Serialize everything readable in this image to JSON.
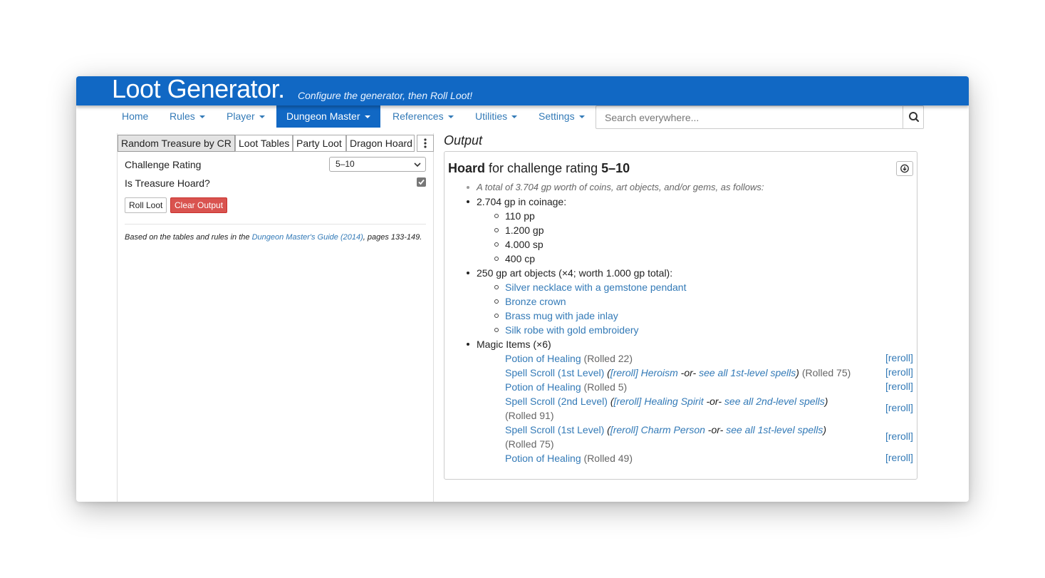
{
  "app": {
    "title": "Loot Generator.",
    "subtitle": "Configure the generator, then Roll Loot!"
  },
  "nav": {
    "items": [
      {
        "label": "Home"
      },
      {
        "label": "Rules"
      },
      {
        "label": "Player"
      },
      {
        "label": "Dungeon Master"
      },
      {
        "label": "References"
      },
      {
        "label": "Utilities"
      },
      {
        "label": "Settings"
      }
    ],
    "active": "Dungeon Master",
    "search_placeholder": "Search everywhere...",
    "search_icon": "search-icon"
  },
  "tabs": [
    {
      "label": "Random Treasure by CR"
    },
    {
      "label": "Loot Tables"
    },
    {
      "label": "Party Loot"
    },
    {
      "label": "Dragon Hoard"
    }
  ],
  "form": {
    "cr_label": "Challenge Rating",
    "cr_value": "5–10",
    "hoard_label": "Is Treasure Hoard?",
    "hoard_checked": true,
    "roll_button": "Roll Loot",
    "clear_button": "Clear Output",
    "note_prefix": "Based on the tables and rules in the ",
    "note_link": "Dungeon Master's Guide (2014)",
    "note_suffix": ", pages 133-149."
  },
  "output": {
    "heading": "Output",
    "title_bold": "Hoard",
    "title_middle": " for challenge rating ",
    "title_cr": "5–10",
    "summary": "A total of 3.704 gp worth of coins, art objects, and/or gems, as follows:",
    "coinage_header": "2.704 gp in coinage:",
    "coins": [
      "110 pp",
      "1.200 gp",
      "4.000 sp",
      "400 cp"
    ],
    "art_header": "250 gp art objects (×4; worth 1.000 gp total):",
    "art_objects": [
      "Silver necklace with a gemstone pendant",
      "Bronze crown",
      "Brass mug with jade inlay",
      "Silk robe with gold embroidery"
    ],
    "magic_header": "Magic Items (×6)",
    "reroll_label": "[reroll]",
    "or_text": " -or- ",
    "magic_items": [
      {
        "name": "Potion of Healing",
        "rolled": "(Rolled 22)"
      },
      {
        "name": "Spell Scroll (1st Level)",
        "spell_reroll": "[reroll]",
        "spell": "Heroism",
        "see_all": "see all 1st-level spells",
        "rolled": "(Rolled 75)"
      },
      {
        "name": "Potion of Healing",
        "rolled": "(Rolled 5)"
      },
      {
        "name": "Spell Scroll (2nd Level)",
        "spell_reroll": "[reroll]",
        "spell": "Healing Spirit",
        "see_all": "see all 2nd-level spells",
        "rolled": "(Rolled 91)"
      },
      {
        "name": "Spell Scroll (1st Level)",
        "spell_reroll": "[reroll]",
        "spell": "Charm Person",
        "see_all": "see all 1st-level spells",
        "rolled": "(Rolled 75)"
      },
      {
        "name": "Potion of Healing",
        "rolled": "(Rolled 49)"
      }
    ]
  },
  "colors": {
    "brand": "#1168c4",
    "link": "#337ab7",
    "danger": "#d9534f"
  }
}
